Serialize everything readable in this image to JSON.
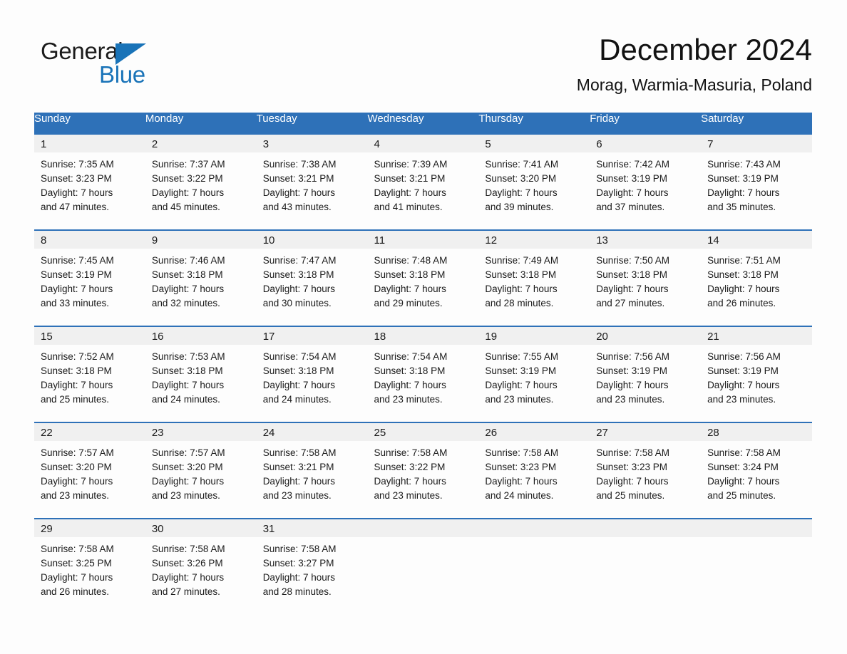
{
  "brand": {
    "name_part1": "General",
    "name_part2": "Blue",
    "triangle_color": "#1973b8"
  },
  "header": {
    "title": "December 2024",
    "subtitle": "Morag, Warmia-Masuria, Poland"
  },
  "theme": {
    "header_blue": "#2e71b8",
    "daynum_band": "#f0f0f0",
    "page_background": "#fdfdfd",
    "text": "#1a1a1a"
  },
  "weekday_headers": [
    "Sunday",
    "Monday",
    "Tuesday",
    "Wednesday",
    "Thursday",
    "Friday",
    "Saturday"
  ],
  "weeks": [
    {
      "days": [
        {
          "date": "1",
          "sunrise": "Sunrise: 7:35 AM",
          "sunset": "Sunset: 3:23 PM",
          "daylight_line1": "Daylight: 7 hours",
          "daylight_line2": "and 47 minutes."
        },
        {
          "date": "2",
          "sunrise": "Sunrise: 7:37 AM",
          "sunset": "Sunset: 3:22 PM",
          "daylight_line1": "Daylight: 7 hours",
          "daylight_line2": "and 45 minutes."
        },
        {
          "date": "3",
          "sunrise": "Sunrise: 7:38 AM",
          "sunset": "Sunset: 3:21 PM",
          "daylight_line1": "Daylight: 7 hours",
          "daylight_line2": "and 43 minutes."
        },
        {
          "date": "4",
          "sunrise": "Sunrise: 7:39 AM",
          "sunset": "Sunset: 3:21 PM",
          "daylight_line1": "Daylight: 7 hours",
          "daylight_line2": "and 41 minutes."
        },
        {
          "date": "5",
          "sunrise": "Sunrise: 7:41 AM",
          "sunset": "Sunset: 3:20 PM",
          "daylight_line1": "Daylight: 7 hours",
          "daylight_line2": "and 39 minutes."
        },
        {
          "date": "6",
          "sunrise": "Sunrise: 7:42 AM",
          "sunset": "Sunset: 3:19 PM",
          "daylight_line1": "Daylight: 7 hours",
          "daylight_line2": "and 37 minutes."
        },
        {
          "date": "7",
          "sunrise": "Sunrise: 7:43 AM",
          "sunset": "Sunset: 3:19 PM",
          "daylight_line1": "Daylight: 7 hours",
          "daylight_line2": "and 35 minutes."
        }
      ]
    },
    {
      "days": [
        {
          "date": "8",
          "sunrise": "Sunrise: 7:45 AM",
          "sunset": "Sunset: 3:19 PM",
          "daylight_line1": "Daylight: 7 hours",
          "daylight_line2": "and 33 minutes."
        },
        {
          "date": "9",
          "sunrise": "Sunrise: 7:46 AM",
          "sunset": "Sunset: 3:18 PM",
          "daylight_line1": "Daylight: 7 hours",
          "daylight_line2": "and 32 minutes."
        },
        {
          "date": "10",
          "sunrise": "Sunrise: 7:47 AM",
          "sunset": "Sunset: 3:18 PM",
          "daylight_line1": "Daylight: 7 hours",
          "daylight_line2": "and 30 minutes."
        },
        {
          "date": "11",
          "sunrise": "Sunrise: 7:48 AM",
          "sunset": "Sunset: 3:18 PM",
          "daylight_line1": "Daylight: 7 hours",
          "daylight_line2": "and 29 minutes."
        },
        {
          "date": "12",
          "sunrise": "Sunrise: 7:49 AM",
          "sunset": "Sunset: 3:18 PM",
          "daylight_line1": "Daylight: 7 hours",
          "daylight_line2": "and 28 minutes."
        },
        {
          "date": "13",
          "sunrise": "Sunrise: 7:50 AM",
          "sunset": "Sunset: 3:18 PM",
          "daylight_line1": "Daylight: 7 hours",
          "daylight_line2": "and 27 minutes."
        },
        {
          "date": "14",
          "sunrise": "Sunrise: 7:51 AM",
          "sunset": "Sunset: 3:18 PM",
          "daylight_line1": "Daylight: 7 hours",
          "daylight_line2": "and 26 minutes."
        }
      ]
    },
    {
      "days": [
        {
          "date": "15",
          "sunrise": "Sunrise: 7:52 AM",
          "sunset": "Sunset: 3:18 PM",
          "daylight_line1": "Daylight: 7 hours",
          "daylight_line2": "and 25 minutes."
        },
        {
          "date": "16",
          "sunrise": "Sunrise: 7:53 AM",
          "sunset": "Sunset: 3:18 PM",
          "daylight_line1": "Daylight: 7 hours",
          "daylight_line2": "and 24 minutes."
        },
        {
          "date": "17",
          "sunrise": "Sunrise: 7:54 AM",
          "sunset": "Sunset: 3:18 PM",
          "daylight_line1": "Daylight: 7 hours",
          "daylight_line2": "and 24 minutes."
        },
        {
          "date": "18",
          "sunrise": "Sunrise: 7:54 AM",
          "sunset": "Sunset: 3:18 PM",
          "daylight_line1": "Daylight: 7 hours",
          "daylight_line2": "and 23 minutes."
        },
        {
          "date": "19",
          "sunrise": "Sunrise: 7:55 AM",
          "sunset": "Sunset: 3:19 PM",
          "daylight_line1": "Daylight: 7 hours",
          "daylight_line2": "and 23 minutes."
        },
        {
          "date": "20",
          "sunrise": "Sunrise: 7:56 AM",
          "sunset": "Sunset: 3:19 PM",
          "daylight_line1": "Daylight: 7 hours",
          "daylight_line2": "and 23 minutes."
        },
        {
          "date": "21",
          "sunrise": "Sunrise: 7:56 AM",
          "sunset": "Sunset: 3:19 PM",
          "daylight_line1": "Daylight: 7 hours",
          "daylight_line2": "and 23 minutes."
        }
      ]
    },
    {
      "days": [
        {
          "date": "22",
          "sunrise": "Sunrise: 7:57 AM",
          "sunset": "Sunset: 3:20 PM",
          "daylight_line1": "Daylight: 7 hours",
          "daylight_line2": "and 23 minutes."
        },
        {
          "date": "23",
          "sunrise": "Sunrise: 7:57 AM",
          "sunset": "Sunset: 3:20 PM",
          "daylight_line1": "Daylight: 7 hours",
          "daylight_line2": "and 23 minutes."
        },
        {
          "date": "24",
          "sunrise": "Sunrise: 7:58 AM",
          "sunset": "Sunset: 3:21 PM",
          "daylight_line1": "Daylight: 7 hours",
          "daylight_line2": "and 23 minutes."
        },
        {
          "date": "25",
          "sunrise": "Sunrise: 7:58 AM",
          "sunset": "Sunset: 3:22 PM",
          "daylight_line1": "Daylight: 7 hours",
          "daylight_line2": "and 23 minutes."
        },
        {
          "date": "26",
          "sunrise": "Sunrise: 7:58 AM",
          "sunset": "Sunset: 3:23 PM",
          "daylight_line1": "Daylight: 7 hours",
          "daylight_line2": "and 24 minutes."
        },
        {
          "date": "27",
          "sunrise": "Sunrise: 7:58 AM",
          "sunset": "Sunset: 3:23 PM",
          "daylight_line1": "Daylight: 7 hours",
          "daylight_line2": "and 25 minutes."
        },
        {
          "date": "28",
          "sunrise": "Sunrise: 7:58 AM",
          "sunset": "Sunset: 3:24 PM",
          "daylight_line1": "Daylight: 7 hours",
          "daylight_line2": "and 25 minutes."
        }
      ]
    },
    {
      "days": [
        {
          "date": "29",
          "sunrise": "Sunrise: 7:58 AM",
          "sunset": "Sunset: 3:25 PM",
          "daylight_line1": "Daylight: 7 hours",
          "daylight_line2": "and 26 minutes."
        },
        {
          "date": "30",
          "sunrise": "Sunrise: 7:58 AM",
          "sunset": "Sunset: 3:26 PM",
          "daylight_line1": "Daylight: 7 hours",
          "daylight_line2": "and 27 minutes."
        },
        {
          "date": "31",
          "sunrise": "Sunrise: 7:58 AM",
          "sunset": "Sunset: 3:27 PM",
          "daylight_line1": "Daylight: 7 hours",
          "daylight_line2": "and 28 minutes."
        },
        {
          "date": "",
          "sunrise": "",
          "sunset": "",
          "daylight_line1": "",
          "daylight_line2": ""
        },
        {
          "date": "",
          "sunrise": "",
          "sunset": "",
          "daylight_line1": "",
          "daylight_line2": ""
        },
        {
          "date": "",
          "sunrise": "",
          "sunset": "",
          "daylight_line1": "",
          "daylight_line2": ""
        },
        {
          "date": "",
          "sunrise": "",
          "sunset": "",
          "daylight_line1": "",
          "daylight_line2": ""
        }
      ]
    }
  ]
}
